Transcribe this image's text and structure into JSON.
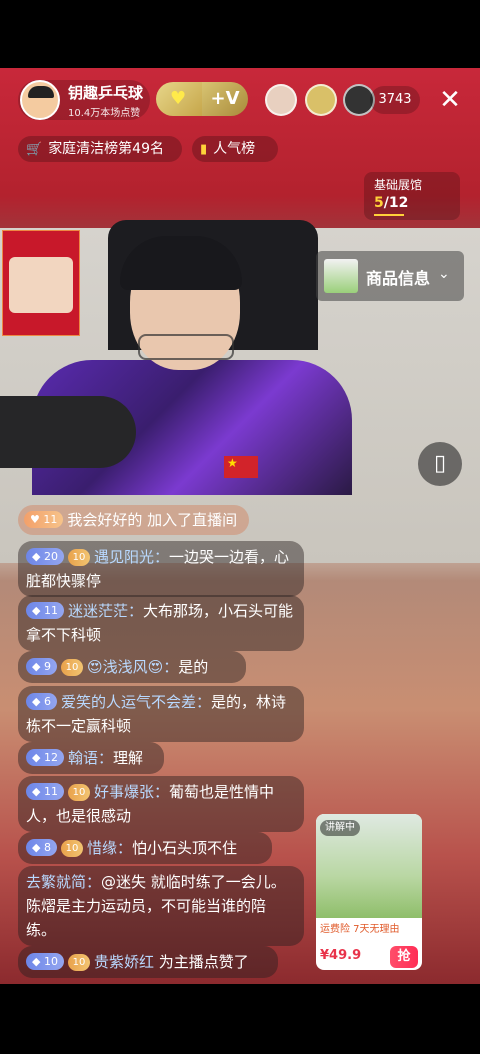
{
  "host": {
    "name": "钥趣乒乓球",
    "likes": "10.4万本场点赞",
    "follow_label": "+V"
  },
  "viewer_count": "3743",
  "pills": {
    "ranking": "家庭清洁榜第49名",
    "popularity": "人气榜"
  },
  "task": {
    "title": "基础展馆",
    "current": "5",
    "total": "/12"
  },
  "goods_button": {
    "label": "商品信息"
  },
  "join_notice": {
    "level": "11",
    "text": "我会好好的 加入了直播间"
  },
  "chat": [
    {
      "level": "20",
      "name": "遇见阳光：",
      "text": "一边哭一边看，心脏都快骤停"
    },
    {
      "level": "11",
      "name": "迷迷茫茫：",
      "text": "大布那场，小石头可能拿不下科顿"
    },
    {
      "level": "9",
      "name": "😍浅浅风😍：",
      "text": "是的"
    },
    {
      "level": "6",
      "name": "爱笑的人运气不会差：",
      "text": "是的，林诗栋不一定赢科顿"
    },
    {
      "level": "12",
      "name": "翰语：",
      "text": "理解"
    },
    {
      "level": "11",
      "name": "好事爆张：",
      "text": "葡萄也是性情中人，也是很感动"
    },
    {
      "level": "8",
      "name": "惜缘：",
      "text": "怕小石头顶不住"
    },
    {
      "level": "",
      "name": "去繁就简：",
      "text": "@迷失 就临时练了一会儿。陈熠是主力运动员，不可能当谁的陪练。"
    },
    {
      "level": "10",
      "name": "贵紫娇红",
      "text": "为主播点赞了"
    }
  ],
  "product_card": {
    "tag": "讲解中",
    "note": "运费险 7天无理由",
    "price": "¥49.9",
    "buy_label": "抢"
  },
  "colors": {
    "accent": "#ffd23a",
    "price": "#e8334a",
    "nick": "#b9d9ff"
  }
}
